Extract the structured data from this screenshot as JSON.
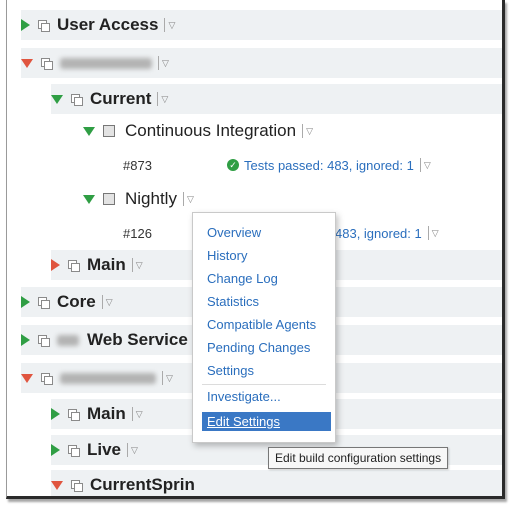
{
  "tree": {
    "user_access": "User Access",
    "current": "Current",
    "continuous_integration": "Continuous Integration",
    "nightly": "Nightly",
    "main": "Main",
    "core": "Core",
    "web_service": "Web Service",
    "main2": "Main",
    "live": "Live",
    "current_spring": "CurrentSprin"
  },
  "builds": {
    "ci_number": "#873",
    "ci_status": "Tests passed: 483, ignored: 1",
    "nightly_number": "#126",
    "nightly_status": "483, ignored: 1"
  },
  "menu": {
    "overview": "Overview",
    "history": "History",
    "change_log": "Change Log",
    "statistics": "Statistics",
    "compatible_agents": "Compatible Agents",
    "pending_changes": "Pending Changes",
    "settings": "Settings",
    "investigate": "Investigate...",
    "edit_settings": "Edit Settings"
  },
  "tooltip": "Edit build configuration settings",
  "icons": {
    "expand": "triangle-right",
    "collapse": "triangle-down",
    "project": "project-icon",
    "config": "build-config-icon",
    "status": "check-circle-icon"
  },
  "colors": {
    "success": "#2f9e44",
    "failure": "#e0553f",
    "link": "#2a6ebd",
    "highlight": "#3a78c5"
  }
}
